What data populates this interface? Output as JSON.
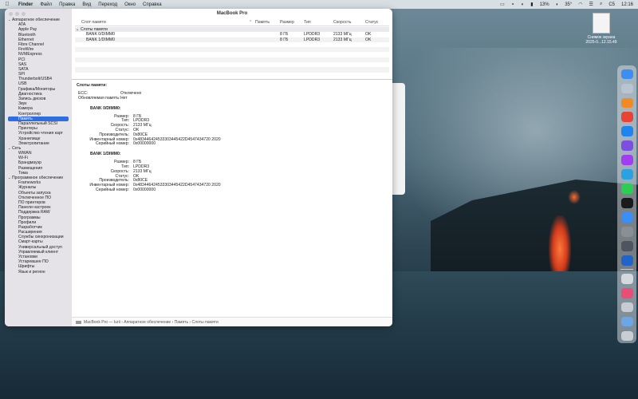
{
  "menubar": {
    "app_name": "Finder",
    "items": [
      "Файл",
      "Правка",
      "Вид",
      "Переход",
      "Окно",
      "Справка"
    ],
    "battery": "13%",
    "volume": "35°",
    "day": "C5",
    "time": "12:16"
  },
  "desktop_file": {
    "name_line1": "Снимок экрана",
    "name_line2": "2025-0...12.15.49"
  },
  "window": {
    "title": "MacBook Pro",
    "sidebar": [
      {
        "label": "Аппаратное обеспечение",
        "level": "group"
      },
      {
        "label": "ATA",
        "level": "child"
      },
      {
        "label": "Apple Pay",
        "level": "child"
      },
      {
        "label": "Bluetooth",
        "level": "child"
      },
      {
        "label": "Ethernet",
        "level": "child"
      },
      {
        "label": "Fibre Channel",
        "level": "child"
      },
      {
        "label": "FireWire",
        "level": "child"
      },
      {
        "label": "NVMExpress",
        "level": "child"
      },
      {
        "label": "PCI",
        "level": "child"
      },
      {
        "label": "SAS",
        "level": "child"
      },
      {
        "label": "SATA",
        "level": "child"
      },
      {
        "label": "SPI",
        "level": "child"
      },
      {
        "label": "Thunderbolt/USB4",
        "level": "child"
      },
      {
        "label": "USB",
        "level": "child"
      },
      {
        "label": "Графика/Мониторы",
        "level": "child"
      },
      {
        "label": "Диагностика",
        "level": "child"
      },
      {
        "label": "Запись дисков",
        "level": "child"
      },
      {
        "label": "Звук",
        "level": "child"
      },
      {
        "label": "Камера",
        "level": "child"
      },
      {
        "label": "Контроллер",
        "level": "child"
      },
      {
        "label": "Память",
        "level": "child",
        "selected": true
      },
      {
        "label": "Параллельный SCSI",
        "level": "child"
      },
      {
        "label": "Принтеры",
        "level": "child"
      },
      {
        "label": "Устройство чтения карт",
        "level": "child"
      },
      {
        "label": "Хранилище",
        "level": "child"
      },
      {
        "label": "Электропитание",
        "level": "child"
      },
      {
        "label": "Сеть",
        "level": "group"
      },
      {
        "label": "WWAN",
        "level": "child"
      },
      {
        "label": "Wi-Fi",
        "level": "child"
      },
      {
        "label": "Брандмауэр",
        "level": "child"
      },
      {
        "label": "Размещения",
        "level": "child"
      },
      {
        "label": "Тома",
        "level": "child"
      },
      {
        "label": "Программное обеспечение",
        "level": "group"
      },
      {
        "label": "Frameworks",
        "level": "child"
      },
      {
        "label": "Журналы",
        "level": "child"
      },
      {
        "label": "Объекты запуска",
        "level": "child"
      },
      {
        "label": "Отключенное ПО",
        "level": "child"
      },
      {
        "label": "ПО принтеров",
        "level": "child"
      },
      {
        "label": "Панели настроек",
        "level": "child"
      },
      {
        "label": "Поддержка RAW",
        "level": "child"
      },
      {
        "label": "Программы",
        "level": "child"
      },
      {
        "label": "Профили",
        "level": "child"
      },
      {
        "label": "Разработчик",
        "level": "child"
      },
      {
        "label": "Расширения",
        "level": "child"
      },
      {
        "label": "Службы синхронизации",
        "level": "child"
      },
      {
        "label": "Смарт-карты",
        "level": "child"
      },
      {
        "label": "Универсальный доступ",
        "level": "child"
      },
      {
        "label": "Управляемый клиент",
        "level": "child"
      },
      {
        "label": "Установки",
        "level": "child"
      },
      {
        "label": "Устаревшее ПО",
        "level": "child"
      },
      {
        "label": "Шрифты",
        "level": "child"
      },
      {
        "label": "Язык и регион",
        "level": "child"
      }
    ],
    "table": {
      "columns": [
        "Слот памяти",
        "Память",
        "Размер",
        "Тип",
        "Скорость",
        "Статус"
      ],
      "group_label": "Слоты памяти",
      "rows": [
        [
          "BANK 0/DIMM0",
          "",
          "8 ГБ",
          "LPDDR3",
          "2133 МГц",
          "OK"
        ],
        [
          "BANK 1/DIMM0",
          "",
          "8 ГБ",
          "LPDDR3",
          "2133 МГц",
          "OK"
        ]
      ]
    },
    "details": {
      "title": "Слоты памяти:",
      "ecc_label": "ECC:",
      "ecc_value": "Отключено",
      "upgradeable_label": "Обновляемая память:",
      "upgradeable_value": "Нет",
      "banks": [
        {
          "title": "BANK 0/DIMM0:",
          "fields": [
            [
              "Размер:",
              "8 ГБ"
            ],
            [
              "Тип:",
              "LPDDR3"
            ],
            [
              "Скорость:",
              "2133 МГц"
            ],
            [
              "Статус:",
              "OK"
            ],
            [
              "Производитель:",
              "0x80CE"
            ],
            [
              "Инвентарный номер:",
              "0x483446424533303445422D4547434720 2020"
            ],
            [
              "Серийный номер:",
              "0x00000000"
            ]
          ]
        },
        {
          "title": "BANK 1/DIMM0:",
          "fields": [
            [
              "Размер:",
              "8 ГБ"
            ],
            [
              "Тип:",
              "LPDDR3"
            ],
            [
              "Скорость:",
              "2133 МГц"
            ],
            [
              "Статус:",
              "OK"
            ],
            [
              "Производитель:",
              "0x80CE"
            ],
            [
              "Инвентарный номер:",
              "0x483446424533303445422D4547434720 2020"
            ],
            [
              "Серийный номер:",
              "0x00000000"
            ]
          ]
        }
      ]
    },
    "statusbar": {
      "path": "MacBook Pro — Iurii › Аппаратное обеспечение › Память › Слоты памяти"
    }
  },
  "dock": {
    "apps": [
      {
        "name": "finder-icon",
        "color": "#3d8ef0"
      },
      {
        "name": "launchpad-icon",
        "color": "#b9c4d0"
      },
      {
        "name": "app-grid-icon",
        "color": "#f08a24"
      },
      {
        "name": "chrome-icon",
        "color": "#e84335"
      },
      {
        "name": "safari-icon",
        "color": "#1f84ef"
      },
      {
        "name": "viber-icon",
        "color": "#7b50e0"
      },
      {
        "name": "messenger-icon",
        "color": "#a23ef2"
      },
      {
        "name": "telegram-icon",
        "color": "#2aa1e0"
      },
      {
        "name": "whatsapp-icon",
        "color": "#2ecc55"
      },
      {
        "name": "spotify-icon",
        "color": "#1a1a1a"
      },
      {
        "name": "mail-icon",
        "color": "#3b8ef3"
      },
      {
        "name": "settings-icon",
        "color": "#8a8f96"
      },
      {
        "name": "sequel-icon",
        "color": "#4f5560"
      },
      {
        "name": "quicktime-icon",
        "color": "#2064c8"
      },
      {
        "name": "window-app-icon",
        "color": "#d5d8de"
      },
      {
        "name": "photos-icon",
        "color": "#e94e77"
      },
      {
        "name": "preview-icon",
        "color": "#c8ccd2"
      },
      {
        "name": "folder-icon",
        "color": "#6ba6e6"
      },
      {
        "name": "trash-icon",
        "color": "#c9ced4"
      }
    ]
  }
}
